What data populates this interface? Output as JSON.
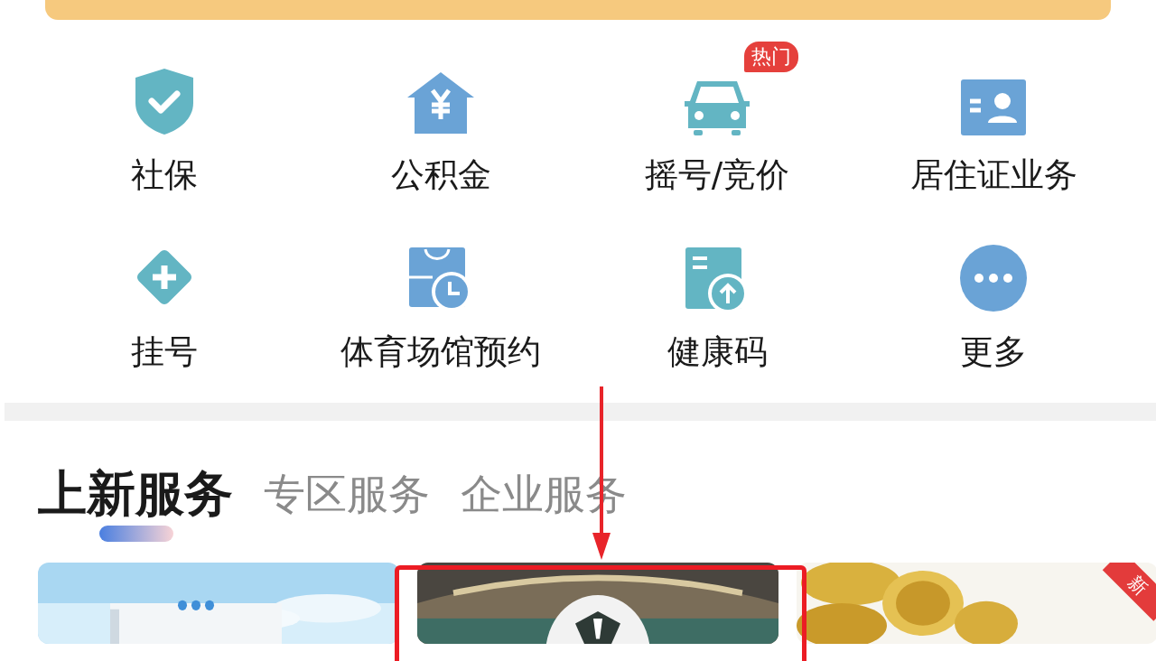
{
  "services": [
    {
      "label": "社保"
    },
    {
      "label": "公积金"
    },
    {
      "label": "摇号/竞价",
      "badge": "热门"
    },
    {
      "label": "居住证业务"
    },
    {
      "label": "挂号"
    },
    {
      "label": "体育场馆预约"
    },
    {
      "label": "健康码"
    },
    {
      "label": "更多"
    }
  ],
  "tabs": [
    {
      "label": "上新服务",
      "selected": true
    },
    {
      "label": "专区服务",
      "selected": false
    },
    {
      "label": "企业服务",
      "selected": false
    }
  ],
  "cards": [
    {
      "kind": "picture"
    },
    {
      "kind": "picture"
    },
    {
      "kind": "picture",
      "ribbon": "新"
    }
  ]
}
